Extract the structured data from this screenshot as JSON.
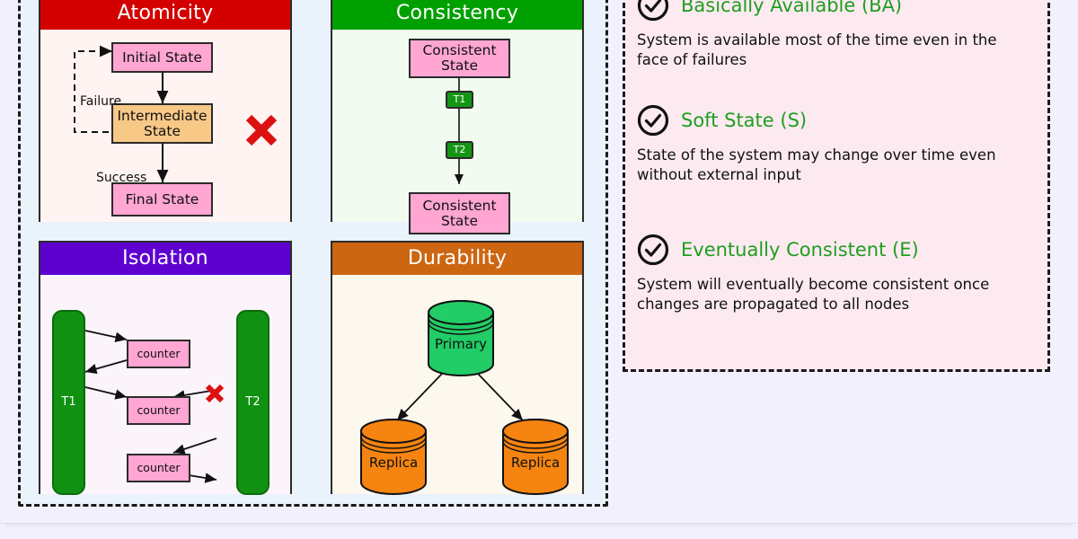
{
  "acid": {
    "panels": [
      {
        "title": "Atomicity",
        "header_color": "#d40000",
        "body_color": "#fff4f1",
        "nodes": [
          {
            "label": "Initial State",
            "kind": "pink"
          },
          {
            "label": "Intermediate State",
            "kind": "orange"
          },
          {
            "label": "Final State",
            "kind": "pink"
          }
        ],
        "edge_labels": [
          "Failure",
          "Success"
        ],
        "marks": [
          "red-x"
        ]
      },
      {
        "title": "Consistency",
        "header_color": "#00a000",
        "body_color": "#f2fbf0",
        "nodes": [
          {
            "label": "Consistent State",
            "kind": "pink"
          },
          {
            "label": "T1",
            "kind": "green"
          },
          {
            "label": "T2",
            "kind": "green"
          },
          {
            "label": "Consistent State",
            "kind": "pink"
          }
        ],
        "edge_labels": [],
        "marks": []
      },
      {
        "title": "Isolation",
        "header_color": "#5e00d0",
        "body_color": "#fbf4fb",
        "nodes": [
          {
            "label": "T1",
            "kind": "bar"
          },
          {
            "label": "T2",
            "kind": "bar"
          },
          {
            "label": "counter",
            "kind": "pink"
          },
          {
            "label": "counter",
            "kind": "pink"
          },
          {
            "label": "counter",
            "kind": "pink"
          }
        ],
        "edge_labels": [],
        "marks": [
          "red-x"
        ]
      },
      {
        "title": "Durability",
        "header_color": "#cc6611",
        "body_color": "#fdf8ee",
        "nodes": [
          {
            "label": "Primary",
            "kind": "cylinder-green"
          },
          {
            "label": "Replica",
            "kind": "cylinder-orange"
          },
          {
            "label": "Replica",
            "kind": "cylinder-orange"
          }
        ],
        "edge_labels": [],
        "marks": []
      }
    ]
  },
  "base": {
    "accent_color": "#1f9e1f",
    "background_color": "#fdeaf1",
    "items": [
      {
        "icon": "check-circle-icon",
        "title": "Basically Available (BA)",
        "description": "System is available most of the time even in the face of failures"
      },
      {
        "icon": "check-circle-icon",
        "title": "Soft State (S)",
        "description": "State of the system may change over time even without external input"
      },
      {
        "icon": "check-circle-icon",
        "title": "Eventually Consistent (E)",
        "description": "System will eventually become consistent once changes are propagated to all nodes"
      }
    ]
  }
}
